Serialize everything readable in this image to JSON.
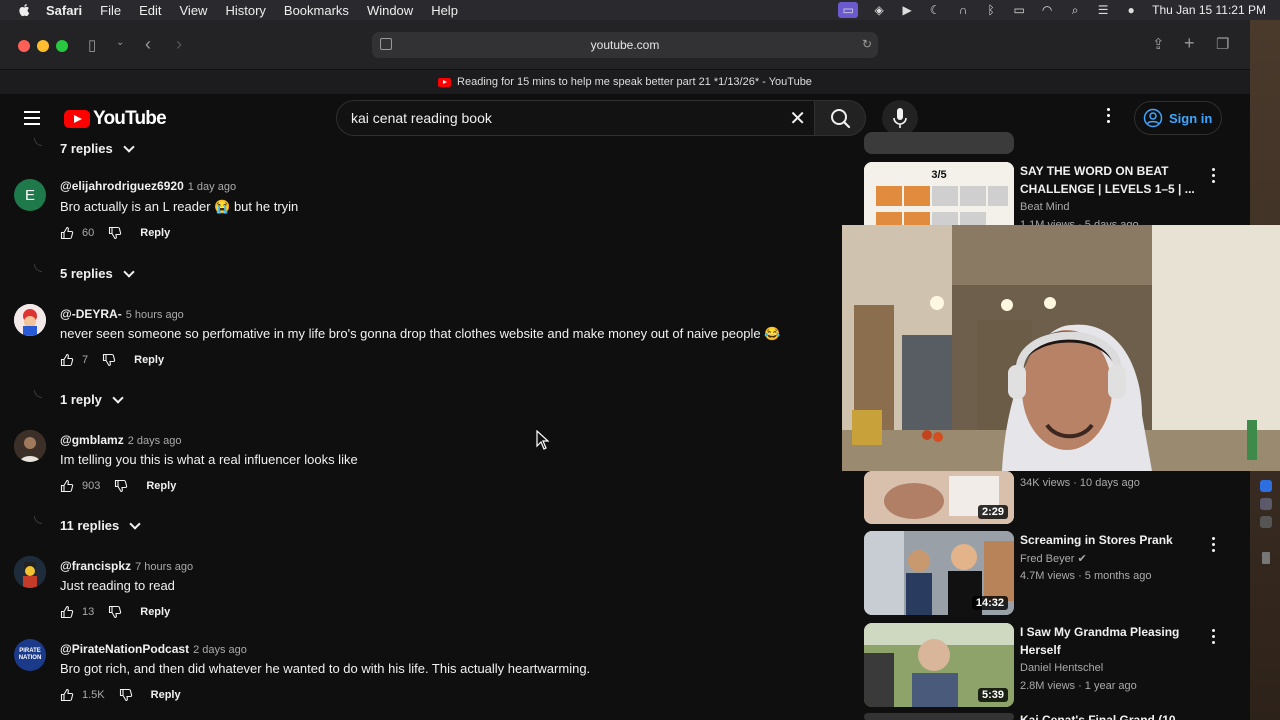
{
  "menubar": {
    "app": "Safari",
    "items": [
      "File",
      "Edit",
      "View",
      "History",
      "Bookmarks",
      "Window",
      "Help"
    ],
    "clock": "Thu Jan 15  11:21 PM"
  },
  "browser": {
    "url": "youtube.com",
    "tab_title": "Reading for 15 mins to help me speak better part 21 *1/13/26* - YouTube"
  },
  "youtube": {
    "logo_text": "YouTube",
    "search_query": "kai cenat reading book",
    "sign_in": "Sign in",
    "accent": "#ff0000",
    "link_color": "#3ea6ff"
  },
  "comments": [
    {
      "replies_above": "7 replies",
      "avatar_letter": "E",
      "avatar_color": "#1e7a4b",
      "handle": "@elijahrodriguez6920",
      "ago": "1 day ago",
      "text": "Bro actually is an L reader 😭 but he tryin",
      "likes": "60",
      "reply": "Reply",
      "replies_below": "5 replies"
    },
    {
      "avatar_letter": "",
      "avatar_color": "#c0392b",
      "handle": "@-DEYRA-",
      "ago": "5 hours ago",
      "text": "never seen someone so perfomative in my life bro's gonna drop that clothes website and make money out of naive people 😂",
      "likes": "7",
      "reply": "Reply",
      "replies_below": "1 reply"
    },
    {
      "avatar_letter": "",
      "avatar_color": "#6b5b4a",
      "handle": "@gmblamz",
      "ago": "2 days ago",
      "text": "Im telling you this is what a real influencer looks like",
      "likes": "903",
      "reply": "Reply",
      "replies_below": "11 replies"
    },
    {
      "avatar_letter": "",
      "avatar_color": "#2d4a6b",
      "handle": "@francispkz",
      "ago": "7 hours ago",
      "text": "Just reading to read",
      "likes": "13",
      "reply": "Reply"
    },
    {
      "avatar_letter": "PIRATE NATION",
      "avatar_color": "#1b3a8a",
      "handle": "@PirateNationPodcast",
      "ago": "2 days ago",
      "text": "Bro got rich, and then did whatever he wanted to do with his life. This actually heartwarming.",
      "likes": "1.5K",
      "reply": "Reply"
    }
  ],
  "sidebar": [
    {
      "title": "SAY THE WORD ON BEAT CHALLENGE | LEVELS 1–5 | ...",
      "channel": "Beat Mind",
      "meta": "1.1M views · 5 days ago",
      "thumb_text": "3/5",
      "thumb_color": "#f4f1ea"
    },
    {
      "title": "",
      "channel": "",
      "meta": "34K views · 10 days ago",
      "duration": "2:29",
      "thumb_color": "#c9a58c"
    },
    {
      "title": "Screaming in Stores Prank",
      "channel": "Fred Beyer ✔",
      "meta": "4.7M views · 5 months ago",
      "duration": "14:32",
      "thumb_color": "#7a6a5a"
    },
    {
      "title": "I Saw My Grandma Pleasing Herself",
      "channel": "Daniel Hentschel",
      "meta": "2.8M views · 1 year ago",
      "duration": "5:39",
      "thumb_color": "#7b8a5c"
    },
    {
      "title": "Kai Cenat's Final Grand (10...",
      "thumb_color": "#333"
    }
  ]
}
